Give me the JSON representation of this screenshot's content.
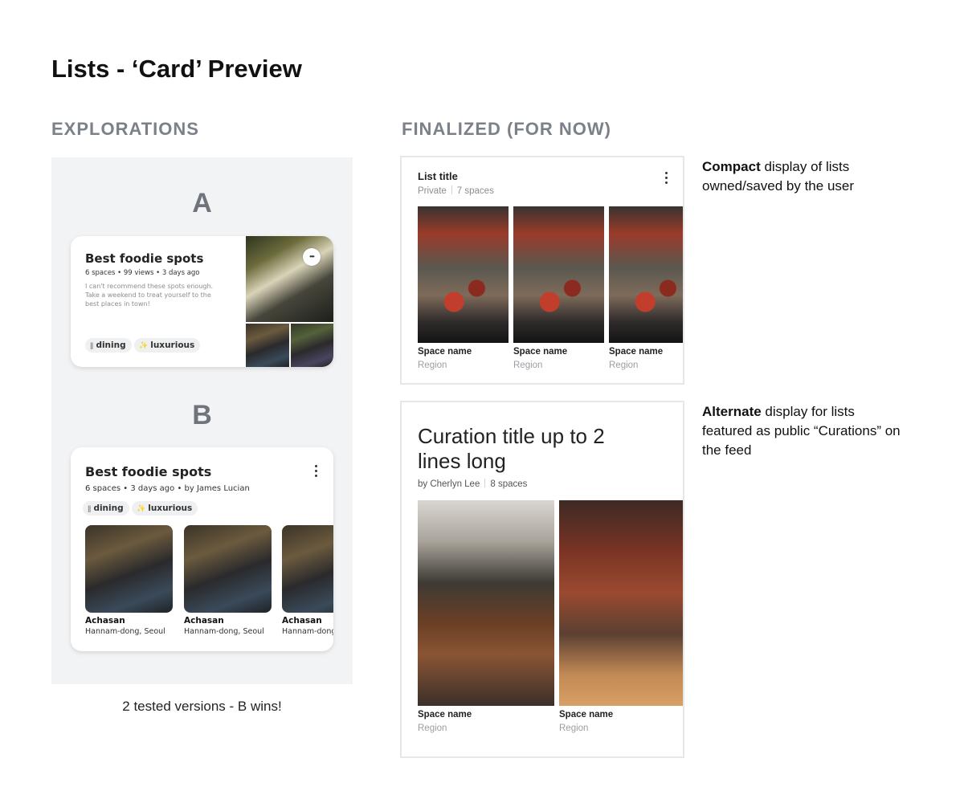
{
  "page": {
    "title": "Lists - ‘Card’ Preview"
  },
  "explorations": {
    "heading": "EXPLORATIONS",
    "caption": "2 tested versions - B wins!",
    "version_a": {
      "letter": "A",
      "title": "Best foodie spots",
      "meta": "6 spaces • 99 views • 3 days ago",
      "description": "I can't recommend these spots enough. Take a weekend to treat yourself to the best places in town!",
      "more": "•••",
      "tags": [
        {
          "icon": "fork-knife-icon",
          "label": "dining"
        },
        {
          "icon": "sparkles-icon",
          "label": "luxurious"
        }
      ]
    },
    "version_b": {
      "letter": "B",
      "title": "Best foodie spots",
      "meta": "6 spaces • 3 days ago • by James Lucian",
      "tags": [
        {
          "icon": "fork-knife-icon",
          "label": "dining"
        },
        {
          "icon": "sparkles-icon",
          "label": "luxurious"
        }
      ],
      "items": [
        {
          "name": "Achasan",
          "location": "Hannam-dong, Seoul"
        },
        {
          "name": "Achasan",
          "location": "Hannam-dong, Seoul"
        },
        {
          "name": "Achasan",
          "location": "Hannam-dong, Seoul"
        }
      ]
    }
  },
  "finalized": {
    "heading": "FINALIZED (FOR NOW)",
    "compact_card": {
      "title": "List title",
      "privacy": "Private",
      "count": "7 spaces",
      "items": [
        {
          "name": "Space name",
          "region": "Region"
        },
        {
          "name": "Space name",
          "region": "Region"
        },
        {
          "name": "Space name",
          "region": "Region"
        }
      ]
    },
    "curation_card": {
      "title": "Curation title up to 2 lines long",
      "author": "by Cherlyn Lee",
      "count": "8 spaces",
      "items": [
        {
          "name": "Space name",
          "region": "Region"
        },
        {
          "name": "Space name",
          "region": "Region"
        }
      ]
    },
    "notes": {
      "compact": {
        "bold": "Compact",
        "rest": " display of lists owned/saved by the user"
      },
      "alternate": {
        "bold": "Alternate",
        "rest": " display for lists featured as public “Curations” on the feed"
      }
    }
  }
}
